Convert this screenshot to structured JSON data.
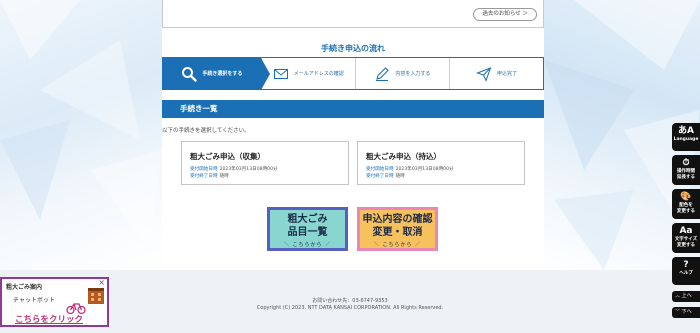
{
  "notice": {
    "past_label": "過去のお知らせ ＞"
  },
  "flow": {
    "title": "手続き申込の流れ",
    "steps": [
      {
        "label": "手続き選択をする",
        "icon": "search-icon"
      },
      {
        "label": "メールアドレスの確認",
        "icon": "mail-icon"
      },
      {
        "label": "内容を入力する",
        "icon": "pencil-icon"
      },
      {
        "label": "申込完了",
        "icon": "send-icon"
      }
    ]
  },
  "procedures": {
    "header": "手続き一覧",
    "instruction": "以下の手続きを選択してください。",
    "cards": [
      {
        "title": "粗大ごみ申込（収集）",
        "start_label": "受付開始日時",
        "start_value": "2023年03月13日08時00分",
        "end_label": "受付終了日時",
        "end_value": "随時"
      },
      {
        "title": "粗大ごみ申込（持込）",
        "start_label": "受付開始日時",
        "start_value": "2023年03月13日08時00分",
        "end_label": "受付終了日時",
        "end_value": "随時"
      }
    ]
  },
  "big_buttons": {
    "list": {
      "line1": "粗大ごみ",
      "line2": "品目一覧",
      "sub": "＼ こちらから ／"
    },
    "confirm": {
      "line1": "申込内容の確認",
      "line2": "変更・取消",
      "sub": "＼ こちらから ／"
    }
  },
  "footer": {
    "inquiry": "お問い合わせ先：03-6747-9353",
    "copyright": "Copyright (C) 2023, NTT DATA KANSAI CORPORATION. All Rights Reserved."
  },
  "chatbot": {
    "title": "粗大ごみ案内",
    "subtitle": "チャットボット",
    "link": "こちらをクリック",
    "close": "×"
  },
  "side_menu": {
    "language": "Language",
    "time_extend_1": "操作時間",
    "time_extend_2": "延長する",
    "color_1": "配色を",
    "color_2": "変更する",
    "font_1": "文字サイズ",
    "font_2": "変更する",
    "help": "ヘルプ",
    "up": "上へ",
    "down": "下へ"
  },
  "colors": {
    "primary": "#1a6fb5",
    "footer_bg": "#eef1f6",
    "chatbot_border": "#8e3a96",
    "chatbot_link": "#c22f78",
    "list_button_bg": "#88d6cf",
    "list_button_border": "#5560c0",
    "confirm_button_bg": "#f7c15e",
    "confirm_button_border": "#e987b5"
  }
}
